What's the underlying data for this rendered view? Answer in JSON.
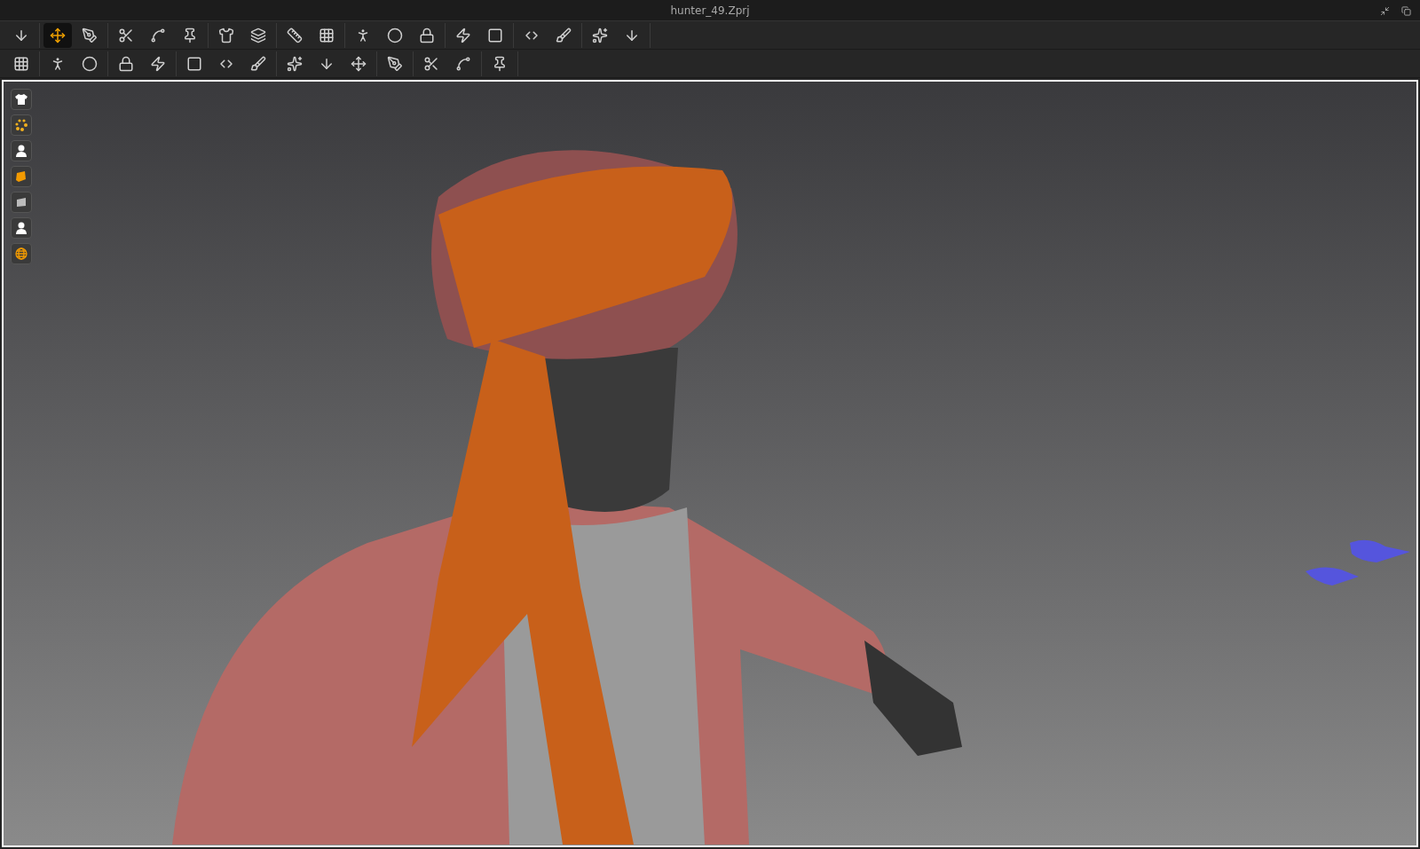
{
  "window": {
    "title": "hunter_49.Zprj"
  },
  "toolbar_rows": [
    [
      [
        {
          "selected": false
        }
      ],
      [
        {
          "selected": true
        },
        {
          "selected": false
        }
      ],
      [
        {
          "selected": false
        },
        {
          "selected": false
        },
        {
          "selected": false
        }
      ],
      [
        {
          "selected": false
        },
        {
          "selected": false
        }
      ],
      [
        {
          "selected": false
        },
        {
          "selected": false
        }
      ],
      [
        {
          "selected": false
        },
        {
          "selected": false
        },
        {
          "selected": false
        }
      ],
      [
        {
          "selected": false
        },
        {
          "selected": false
        }
      ],
      [
        {
          "selected": false
        },
        {
          "selected": false
        }
      ],
      [
        {
          "selected": false
        },
        {
          "selected": false
        }
      ]
    ],
    [
      [
        {
          "selected": false
        }
      ],
      [
        {
          "selected": false
        },
        {
          "selected": false
        }
      ],
      [
        {
          "selected": false
        },
        {
          "selected": false
        }
      ],
      [
        {
          "selected": false
        },
        {
          "selected": false
        },
        {
          "selected": false
        }
      ],
      [
        {
          "selected": false
        },
        {
          "selected": false
        },
        {
          "selected": false
        }
      ],
      [
        {
          "selected": false
        }
      ],
      [
        {
          "selected": false
        },
        {
          "selected": false
        }
      ],
      [
        {
          "selected": false
        }
      ]
    ]
  ],
  "viewport": {
    "active": true
  },
  "side_tools": [
    {
      "kind": "garment"
    },
    {
      "kind": "points"
    },
    {
      "kind": "avatar"
    },
    {
      "kind": "fabric"
    },
    {
      "kind": "texture"
    },
    {
      "kind": "avatar"
    },
    {
      "kind": "globe"
    }
  ]
}
